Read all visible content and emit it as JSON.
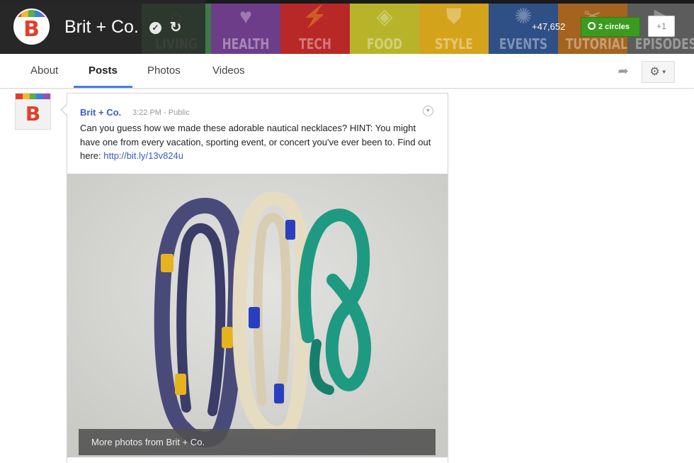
{
  "page": {
    "name": "Brit + Co.",
    "avatar_letter": "B",
    "brand_color": "#e0402a",
    "avatar_stripe_colors": [
      "#e0402a",
      "#f2b631",
      "#55b04a",
      "#3f7ed8",
      "#9b4fb8"
    ]
  },
  "cover": {
    "categories": [
      {
        "label": "LIVING",
        "color": "#3f7a4a",
        "icon": "house-icon",
        "glyph": "⌂"
      },
      {
        "label": "HEALTH",
        "color": "#6e3d8a",
        "icon": "heart-icon",
        "glyph": "♥"
      },
      {
        "label": "TECH",
        "color": "#b82826",
        "icon": "plug-icon",
        "glyph": "⚡"
      },
      {
        "label": "FOOD",
        "color": "#b8b42a",
        "icon": "cake-icon",
        "glyph": "◈"
      },
      {
        "label": "STYLE",
        "color": "#d4a31c",
        "icon": "shirt-icon",
        "glyph": "⛊"
      },
      {
        "label": "EVENTS",
        "color": "#2f4f87",
        "icon": "bulb-icon",
        "glyph": "✺"
      },
      {
        "label": "TUTORIALS",
        "color": "#a4631f",
        "icon": "scissors-icon",
        "glyph": "✂"
      },
      {
        "label": "EPISODES",
        "color": "#5c5c5c",
        "icon": "play-icon",
        "glyph": "▶"
      }
    ],
    "follower_count": "+47,652",
    "circles_label": "2 circles",
    "plus_one_label": "+1",
    "circles_color": "#3a9b1e"
  },
  "tabs": [
    {
      "label": "About",
      "active": false
    },
    {
      "label": "Posts",
      "active": true
    },
    {
      "label": "Photos",
      "active": false
    },
    {
      "label": "Videos",
      "active": false
    }
  ],
  "post": {
    "author": "Brit + Co.",
    "time": "3:22 PM",
    "separator": "-",
    "visibility": "Public",
    "text": "Can you guess how we made these adorable nautical necklaces? HINT: You might have one from every vacation, sporting event, or concert you've ever been to. Find out here: ",
    "link": "http://bit.ly/13v824u",
    "more_photos_label": "More photos from Brit + Co."
  },
  "colors": {
    "link": "#3a5bbf",
    "tab_accent": "#427fed",
    "necklace_navy": "#4a4a7a",
    "necklace_cream": "#e6dcc2",
    "necklace_teal": "#1e9a82",
    "band_yellow": "#e6b21e",
    "band_blue": "#2a3fbf"
  }
}
